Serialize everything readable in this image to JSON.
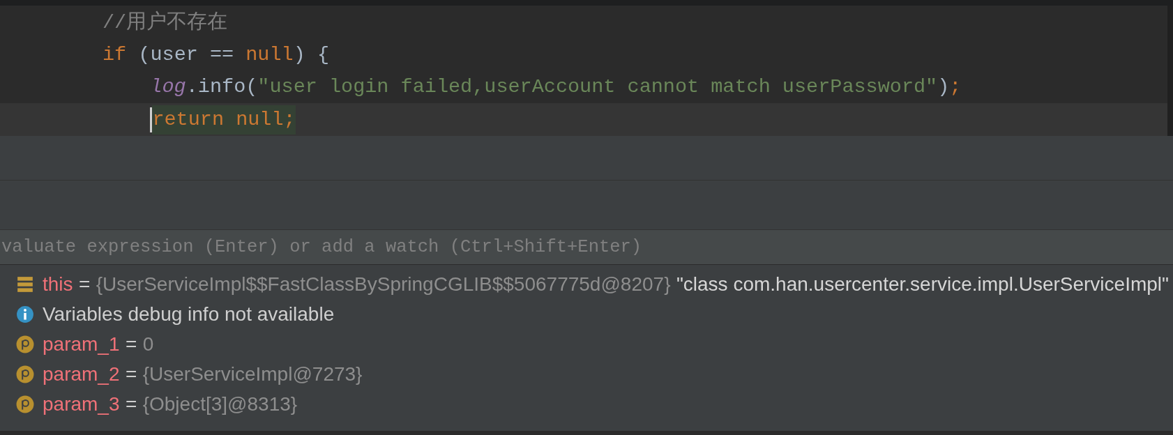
{
  "editor": {
    "lines": [
      {
        "current": false,
        "tokens": [
          {
            "kind": "comment",
            "text": "//用户不存在"
          }
        ]
      },
      {
        "current": false,
        "tokens": [
          {
            "kind": "keyword",
            "text": "if"
          },
          {
            "kind": "plain",
            "text": " (user == "
          },
          {
            "kind": "keyword",
            "text": "null"
          },
          {
            "kind": "plain",
            "text": ") {"
          }
        ],
        "children": [
          {
            "current": false,
            "tokens": [
              {
                "kind": "field",
                "text": "log"
              },
              {
                "kind": "plain",
                "text": ".info("
              },
              {
                "kind": "string",
                "text": "\"user login failed,userAccount cannot match userPassword\""
              },
              {
                "kind": "plain",
                "text": ")"
              },
              {
                "kind": "keyword",
                "text": ";"
              }
            ]
          },
          {
            "current": true,
            "tokens": [
              {
                "kind": "keyword-highlighted",
                "text": "return null;"
              }
            ]
          }
        ]
      }
    ]
  },
  "debugger": {
    "evaluate": {
      "placeholder": "valuate expression (Enter) or add a watch (Ctrl+Shift+Enter)"
    },
    "variables": [
      {
        "kind": "object",
        "name": "this",
        "operator": "=",
        "value": "{UserServiceImpl$$FastClassBySpringCGLIB$$5067775d@8207}",
        "extra": "\"class com.han.usercenter.service.impl.UserServiceImpl\""
      },
      {
        "kind": "info",
        "message": "Variables debug info not available"
      },
      {
        "kind": "param",
        "name": "param_1",
        "operator": "=",
        "value": "0"
      },
      {
        "kind": "param",
        "name": "param_2",
        "operator": "=",
        "value": "{UserServiceImpl@7273}"
      },
      {
        "kind": "param",
        "name": "param_3",
        "operator": "=",
        "value": "{Object[3]@8313}"
      }
    ]
  }
}
